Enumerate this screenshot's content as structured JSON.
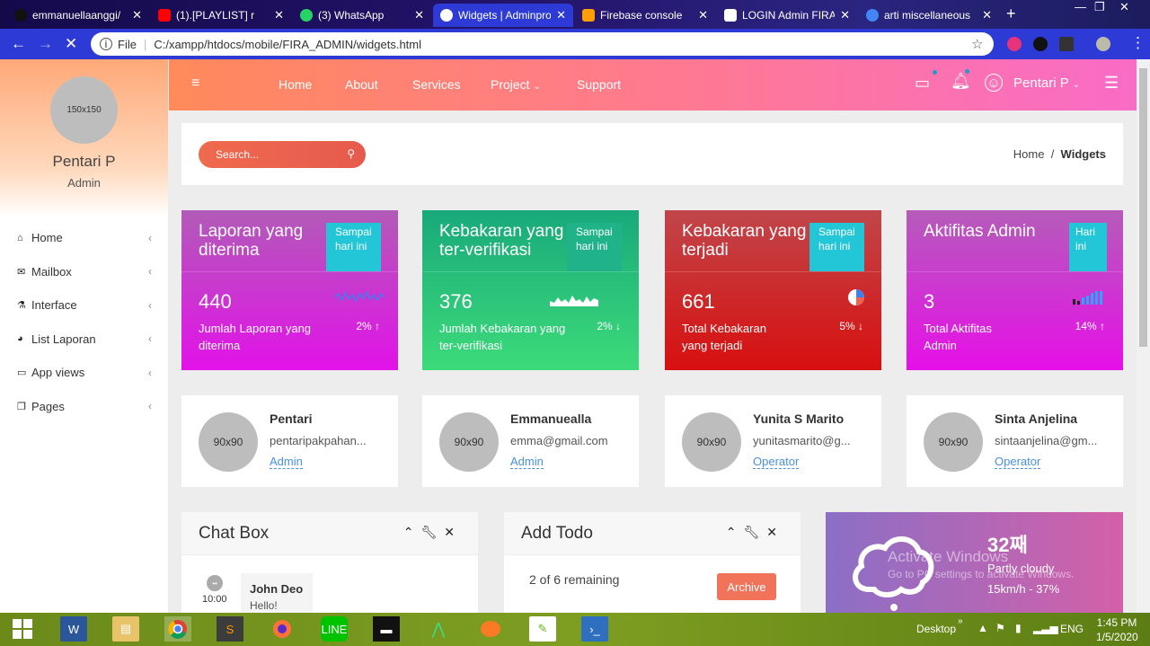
{
  "browser": {
    "tabs": [
      {
        "label": "emmanuellaanggi/",
        "color": "#111111"
      },
      {
        "label": "(1).[PLAYLIST] r",
        "color": "#ff0000"
      },
      {
        "label": "(3) WhatsApp",
        "color": "#25d366"
      },
      {
        "label": "Widgets | Adminpro",
        "color": "#ffffff"
      },
      {
        "label": "Firebase console",
        "color": "#ffa000"
      },
      {
        "label": "LOGIN Admin FIRA",
        "color": "#ffffff"
      },
      {
        "label": "arti miscellaneous",
        "color": "#4285f4"
      }
    ],
    "url_prefix": "File",
    "url": "C:/xampp/htdocs/mobile/FIRA_ADMIN/widgets.html"
  },
  "sidebar": {
    "avatar_placeholder": "150x150",
    "user_name": "Pentari P",
    "user_role": "Admin",
    "items": [
      {
        "label": "Home",
        "icon": "home-icon",
        "glyph": "⌂"
      },
      {
        "label": "Mailbox",
        "icon": "envelope-icon",
        "glyph": "✉"
      },
      {
        "label": "Interface",
        "icon": "flask-icon",
        "glyph": "⚗"
      },
      {
        "label": "List Laporan",
        "icon": "pie-chart-icon",
        "glyph": "◕"
      },
      {
        "label": "App views",
        "icon": "monitor-icon",
        "glyph": "▭"
      },
      {
        "label": "Pages",
        "icon": "copy-icon",
        "glyph": "❐"
      }
    ]
  },
  "topnav": {
    "links": [
      "Home",
      "About",
      "Services",
      "Project",
      "Support"
    ],
    "user": "Pentari P"
  },
  "search": {
    "placeholder": "Search..."
  },
  "breadcrumb": {
    "home": "Home",
    "sep": "/",
    "current": "Widgets"
  },
  "stats": [
    {
      "title": "Laporan yang diterima",
      "badge": "Sampai hari ini",
      "value": "440",
      "desc": "Jumlah Laporan yang diterima",
      "pct": "2%",
      "arrow": "↑",
      "gradient": [
        "#b25bb8",
        "#e212e8"
      ],
      "badge_bg": "#22c6d6"
    },
    {
      "title": "Kebakaran yang ter-verifikasi",
      "badge": "Sampai hari ini",
      "value": "376",
      "desc": "Jumlah Kebakaran yang ter-verifikasi",
      "pct": "2%",
      "arrow": "↓",
      "gradient": [
        "#18a97a",
        "#3ddb7a"
      ],
      "badge_bg": "#20b38a"
    },
    {
      "title": "Kebakaran yang terjadi",
      "badge": "Sampai hari ini",
      "value": "661",
      "desc": "Total Kebakaran yang terjadi",
      "pct": "5%",
      "arrow": "↓",
      "gradient": [
        "#c0464a",
        "#d80f0f"
      ],
      "badge_bg": "#22c6d6"
    },
    {
      "title": "Aktifitas Admin",
      "badge": "Hari ini",
      "value": "3",
      "desc": "Total Aktifitas Admin",
      "pct": "14%",
      "arrow": "↑",
      "gradient": [
        "#b55cba",
        "#e60fe8"
      ],
      "badge_bg": "#22c6d6"
    }
  ],
  "users": [
    {
      "avatar": "90x90",
      "name": "Pentari",
      "email": "pentaripakpahan...",
      "role": "Admin"
    },
    {
      "avatar": "90x90",
      "name": "Emmanuealla",
      "email": "emma@gmail.com",
      "role": "Admin"
    },
    {
      "avatar": "90x90",
      "name": "Yunita S Marito",
      "email": "yunitasmarito@g...",
      "role": "Operator"
    },
    {
      "avatar": "90x90",
      "name": "Sinta Anjelina",
      "email": "sintaanjelina@gm...",
      "role": "Operator"
    }
  ],
  "chat": {
    "title": "Chat Box",
    "time": "10:00",
    "name": "John Deo",
    "message": "Hello!"
  },
  "todo": {
    "title": "Add Todo",
    "remaining": "2 of 6 remaining",
    "archive": "Archive"
  },
  "weather": {
    "temp": "32째",
    "condition": "Partly cloudy",
    "wind": "15km/h - 37%"
  },
  "watermark": {
    "line1": "Activate Windows",
    "line2": "Go to PC settings to activate Windows."
  },
  "taskbar": {
    "desktop": "Desktop",
    "lang": "ENG",
    "time": "1:45 PM",
    "date": "1/5/2020"
  }
}
